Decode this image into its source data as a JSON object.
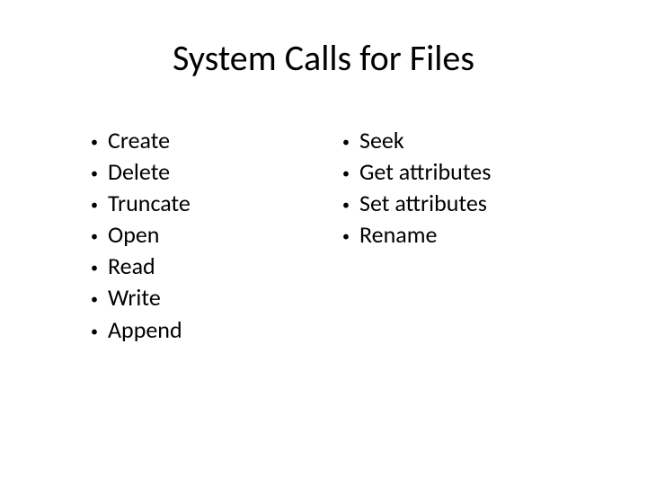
{
  "title": "System Calls for Files",
  "left": {
    "items": [
      "Create",
      "Delete",
      "Truncate",
      "Open",
      "Read",
      "Write",
      "Append"
    ]
  },
  "right": {
    "items": [
      "Seek",
      "Get attributes",
      "Set attributes",
      "Rename"
    ]
  }
}
